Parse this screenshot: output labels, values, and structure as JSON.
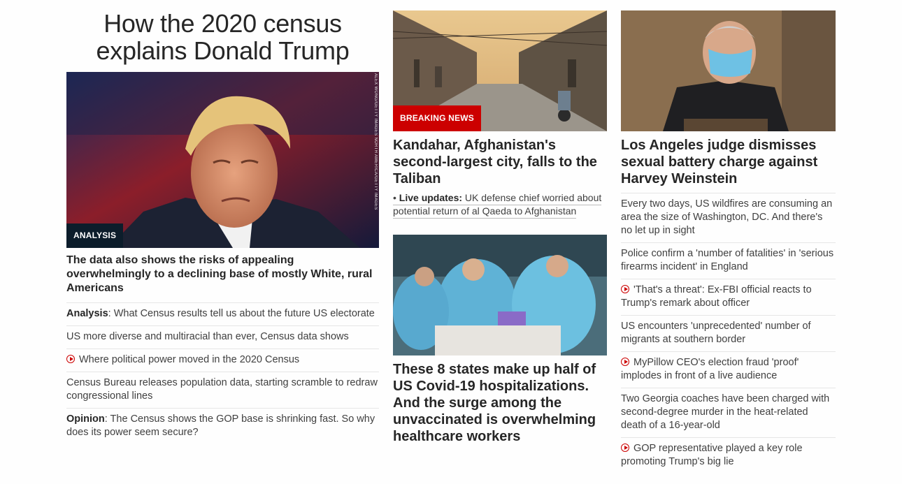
{
  "col1": {
    "headline": "How the 2020 census explains Donald Trump",
    "label": "ANALYSIS",
    "photo_credit": "ALEX WONG/GETTY IMAGES NORTH AMERICA/GETTY IMAGES",
    "lead": "The data also shows the risks of appealing overwhelmingly to a declining base of mostly White, rural Americans",
    "items": [
      {
        "bold": "Analysis",
        "text": ": What Census results tell us about the future US electorate"
      },
      {
        "text": "US more diverse and multiracial than ever, Census data shows"
      },
      {
        "text": "Where political power moved in the 2020 Census",
        "video": true
      },
      {
        "text": "Census Bureau releases population data, starting scramble to redraw congressional lines"
      },
      {
        "bold": "Opinion",
        "text": ": The Census shows the GOP base is shrinking fast. So why does its power seem secure?"
      }
    ]
  },
  "col2": {
    "story1": {
      "label": "BREAKING NEWS",
      "title": "Kandahar, Afghanistan's second-largest city, falls to the Taliban",
      "bullet": "• ",
      "live_label": "Live updates:",
      "live_text": " UK defense chief worried about potential return of al Qaeda to Afghanistan"
    },
    "story2": {
      "title": "These 8 states make up half of US Covid-19 hospitalizations. And the surge among the unvaccinated is overwhelming healthcare workers"
    }
  },
  "col3": {
    "title": "Los Angeles judge dismisses sexual battery charge against Harvey Weinstein",
    "items": [
      {
        "text": "Every two days, US wildfires are consuming an area the size of Washington, DC. And there's no let up in sight"
      },
      {
        "text": "Police confirm a 'number of fatalities' in 'serious firearms incident' in England"
      },
      {
        "text": "'That's a threat': Ex-FBI official reacts to Trump's remark about officer",
        "video": true
      },
      {
        "text": "US encounters 'unprecedented' number of migrants at southern border"
      },
      {
        "text": "MyPillow CEO's election fraud 'proof' implodes in front of a live audience",
        "video": true
      },
      {
        "text": "Two Georgia coaches have been charged with second-degree murder in the heat-related death of a 16-year-old"
      },
      {
        "text": "GOP representative played a key role promoting Trump's big lie",
        "video": true
      }
    ]
  },
  "colors": {
    "breaking": "#cc0000",
    "analysis": "#0c1d2b",
    "video": "#cc0000"
  },
  "icons": {
    "video": "play-circle-icon"
  }
}
